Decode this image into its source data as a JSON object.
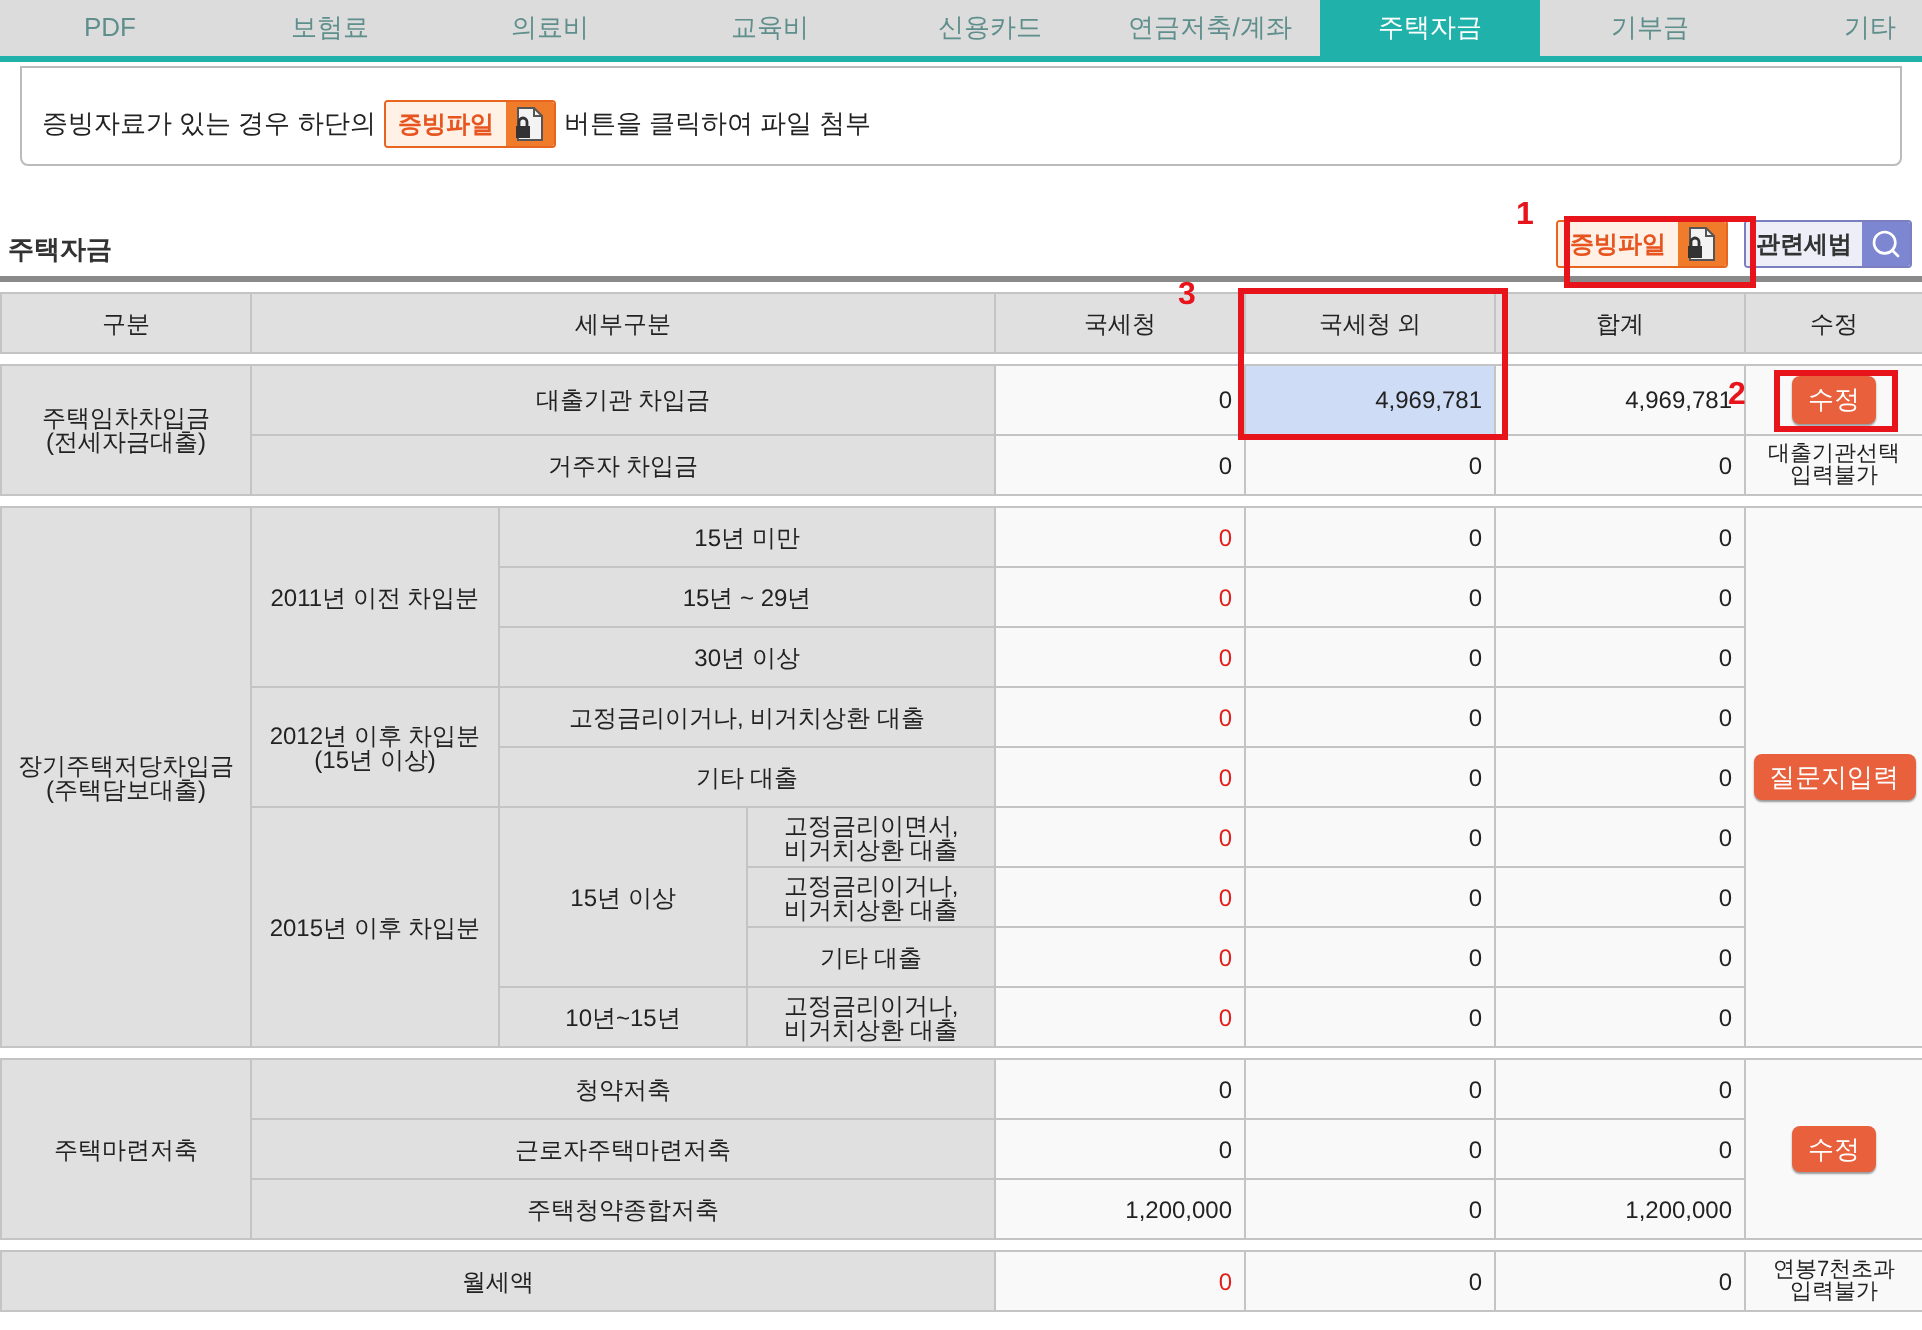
{
  "tabs": [
    {
      "label": "PDF",
      "selected": false
    },
    {
      "label": "보험료",
      "selected": false
    },
    {
      "label": "의료비",
      "selected": false
    },
    {
      "label": "교육비",
      "selected": false
    },
    {
      "label": "신용카드",
      "selected": false
    },
    {
      "label": "연금저축/계좌",
      "selected": false
    },
    {
      "label": "주택자금",
      "selected": true
    },
    {
      "label": "기부금",
      "selected": false
    },
    {
      "label": "기타",
      "selected": false
    }
  ],
  "notice": {
    "before": "증빙자료가 있는 경우 하단의",
    "badge": "증빙파일",
    "after": "버튼을 클릭하여 파일 첨부"
  },
  "section": {
    "title": "주택자금",
    "evidence_button": "증빙파일",
    "law_button": "관련세법"
  },
  "table": {
    "columns": [
      "구분",
      "세부구분",
      "국세청",
      "국세청 외",
      "합계",
      "수정"
    ],
    "groups": [
      {
        "label": "주택임차차입금\n(전세자금대출)",
        "children": [
          {
            "label": "대출기관 차입금",
            "values": [
              {
                "text": "0",
                "alert": false,
                "highlighted": false
              },
              {
                "text": "4,969,781",
                "alert": false,
                "highlighted": true
              },
              {
                "text": "4,969,781",
                "alert": false,
                "highlighted": false
              }
            ],
            "action": {
              "kind": "button",
              "label": "수정"
            }
          },
          {
            "label": "거주자 차입금",
            "values": [
              {
                "text": "0",
                "alert": false,
                "highlighted": false
              },
              {
                "text": "0",
                "alert": false,
                "highlighted": false
              },
              {
                "text": "0",
                "alert": false,
                "highlighted": false
              }
            ],
            "action": {
              "kind": "note",
              "label": "대출기관선택 입력불가"
            }
          }
        ]
      },
      {
        "label": "장기주택저당차입금\n(주택담보대출)",
        "action": {
          "kind": "button",
          "label": "질문지입력"
        },
        "children": [
          {
            "label": "2011년 이전 차입분",
            "children": [
              {
                "label": "15년 미만",
                "values": [
                  {
                    "text": "0",
                    "alert": true,
                    "highlighted": false
                  },
                  {
                    "text": "0",
                    "alert": false,
                    "highlighted": false
                  },
                  {
                    "text": "0",
                    "alert": false,
                    "highlighted": false
                  }
                ]
              },
              {
                "label": "15년 ~ 29년",
                "values": [
                  {
                    "text": "0",
                    "alert": true,
                    "highlighted": false
                  },
                  {
                    "text": "0",
                    "alert": false,
                    "highlighted": false
                  },
                  {
                    "text": "0",
                    "alert": false,
                    "highlighted": false
                  }
                ]
              },
              {
                "label": "30년 이상",
                "values": [
                  {
                    "text": "0",
                    "alert": true,
                    "highlighted": false
                  },
                  {
                    "text": "0",
                    "alert": false,
                    "highlighted": false
                  },
                  {
                    "text": "0",
                    "alert": false,
                    "highlighted": false
                  }
                ]
              }
            ]
          },
          {
            "label": "2012년 이후 차입분\n(15년 이상)",
            "children": [
              {
                "label": "고정금리이거나, 비거치상환 대출",
                "values": [
                  {
                    "text": "0",
                    "alert": true,
                    "highlighted": false
                  },
                  {
                    "text": "0",
                    "alert": false,
                    "highlighted": false
                  },
                  {
                    "text": "0",
                    "alert": false,
                    "highlighted": false
                  }
                ]
              },
              {
                "label": "기타 대출",
                "values": [
                  {
                    "text": "0",
                    "alert": true,
                    "highlighted": false
                  },
                  {
                    "text": "0",
                    "alert": false,
                    "highlighted": false
                  },
                  {
                    "text": "0",
                    "alert": false,
                    "highlighted": false
                  }
                ]
              }
            ]
          },
          {
            "label": "2015년 이후 차입분",
            "children": [
              {
                "label": "15년 이상",
                "children": [
                  {
                    "label": "고정금리이면서,\n비거치상환 대출",
                    "values": [
                      {
                        "text": "0",
                        "alert": true,
                        "highlighted": false
                      },
                      {
                        "text": "0",
                        "alert": false,
                        "highlighted": false
                      },
                      {
                        "text": "0",
                        "alert": false,
                        "highlighted": false
                      }
                    ]
                  },
                  {
                    "label": "고정금리이거나,\n비거치상환 대출",
                    "values": [
                      {
                        "text": "0",
                        "alert": true,
                        "highlighted": false
                      },
                      {
                        "text": "0",
                        "alert": false,
                        "highlighted": false
                      },
                      {
                        "text": "0",
                        "alert": false,
                        "highlighted": false
                      }
                    ]
                  },
                  {
                    "label": "기타 대출",
                    "values": [
                      {
                        "text": "0",
                        "alert": true,
                        "highlighted": false
                      },
                      {
                        "text": "0",
                        "alert": false,
                        "highlighted": false
                      },
                      {
                        "text": "0",
                        "alert": false,
                        "highlighted": false
                      }
                    ]
                  }
                ]
              },
              {
                "label": "10년~15년",
                "children": [
                  {
                    "label": "고정금리이거나,\n비거치상환 대출",
                    "values": [
                      {
                        "text": "0",
                        "alert": true,
                        "highlighted": false
                      },
                      {
                        "text": "0",
                        "alert": false,
                        "highlighted": false
                      },
                      {
                        "text": "0",
                        "alert": false,
                        "highlighted": false
                      }
                    ]
                  }
                ]
              }
            ]
          }
        ]
      },
      {
        "label": "주택마련저축",
        "action": {
          "kind": "button",
          "label": "수정"
        },
        "children": [
          {
            "label": "청약저축",
            "values": [
              {
                "text": "0",
                "alert": false,
                "highlighted": false
              },
              {
                "text": "0",
                "alert": false,
                "highlighted": false
              },
              {
                "text": "0",
                "alert": false,
                "highlighted": false
              }
            ]
          },
          {
            "label": "근로자주택마련저축",
            "values": [
              {
                "text": "0",
                "alert": false,
                "highlighted": false
              },
              {
                "text": "0",
                "alert": false,
                "highlighted": false
              },
              {
                "text": "0",
                "alert": false,
                "highlighted": false
              }
            ]
          },
          {
            "label": "주택청약종합저축",
            "values": [
              {
                "text": "1,200,000",
                "alert": false,
                "highlighted": false
              },
              {
                "text": "0",
                "alert": false,
                "highlighted": false
              },
              {
                "text": "1,200,000",
                "alert": false,
                "highlighted": false
              }
            ]
          }
        ]
      },
      {
        "label": "월세액",
        "values": [
          {
            "text": "0",
            "alert": true,
            "highlighted": false
          },
          {
            "text": "0",
            "alert": false,
            "highlighted": false
          },
          {
            "text": "0",
            "alert": false,
            "highlighted": false
          }
        ],
        "action": {
          "kind": "note",
          "label": "연봉7천초과 입력불가"
        }
      }
    ]
  },
  "annotations": [
    {
      "label": "1"
    },
    {
      "label": "2"
    },
    {
      "label": "3"
    }
  ]
}
